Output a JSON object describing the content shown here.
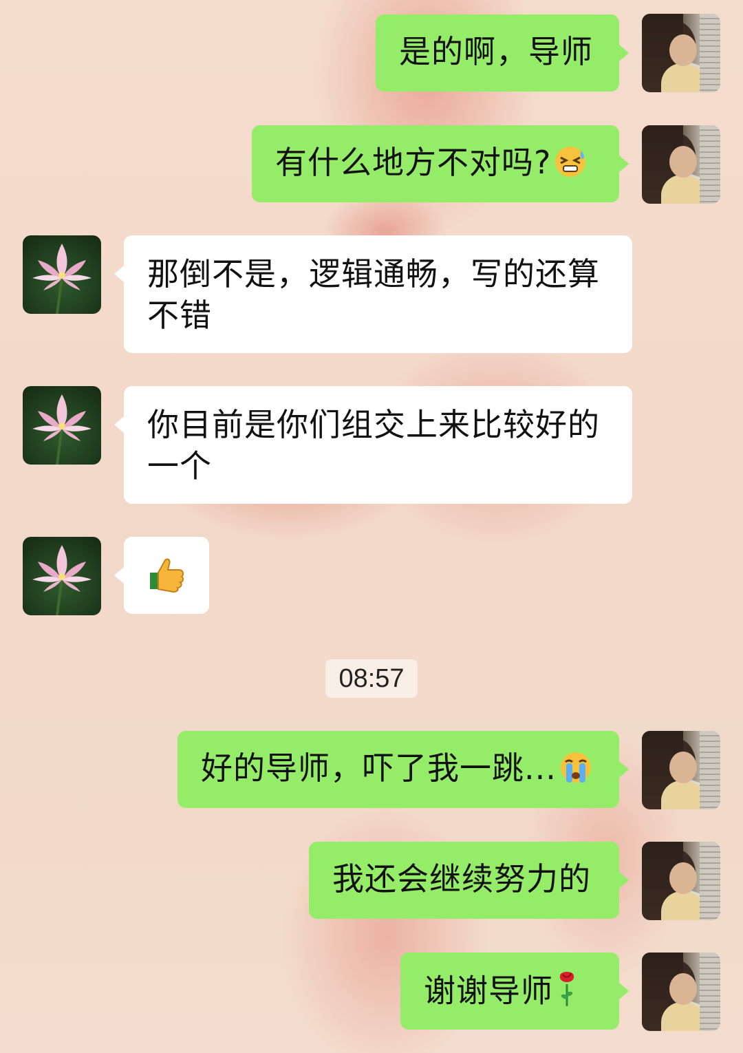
{
  "chat": {
    "timestamp": "08:57",
    "messages": [
      {
        "sender": "self",
        "text": "是的啊，导师"
      },
      {
        "sender": "self",
        "text": "有什么地方不对吗?",
        "emoji": "grimace-sweat-emoji"
      },
      {
        "sender": "other",
        "text": "那倒不是，逻辑通畅，写的还算不错"
      },
      {
        "sender": "other",
        "text": "你目前是你们组交上来比较好的一个"
      },
      {
        "sender": "other",
        "text": "",
        "emoji": "thumbs-up-emoji"
      },
      {
        "sender": "self",
        "text": "好的导师，吓了我一跳...",
        "emoji": "crying-emoji"
      },
      {
        "sender": "self",
        "text": "我还会继续努力的"
      },
      {
        "sender": "self",
        "text": "谢谢导师",
        "emoji": "rose-emoji"
      }
    ]
  },
  "colors": {
    "self_bubble": "#95ec69",
    "other_bubble": "#ffffff",
    "background": "#f3dccd"
  }
}
